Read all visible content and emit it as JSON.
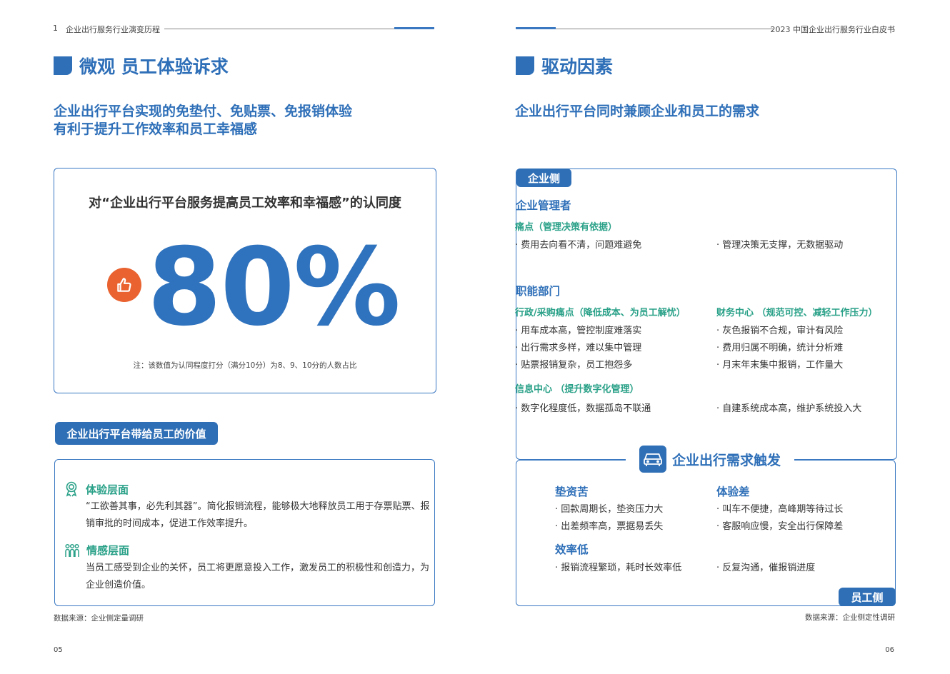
{
  "left_page": {
    "header": {
      "chapter_no": "1",
      "chapter_title": "企业出行服务行业演变历程"
    },
    "section_title": "微观 员工体验诉求",
    "subtitle_lines": [
      "企业出行平台实现的免垫付、免贴票、免报销体验",
      "有利于提升工作效率和员工幸福感"
    ],
    "stat": {
      "question": "对“企业出行平台服务提高员工效率和幸福感”的认同度",
      "value": "80%",
      "note": "注：该数值为认同程度打分（满分10分）为8、9、10分的人数占比"
    },
    "value_pill": "企业出行平台带给员工的价值",
    "levels": [
      {
        "title": "体验层面",
        "icon": "award-icon",
        "body": "“工欲善其事，必先利其器”。简化报销流程，能够极大地释放员工用于存票贴票、报销审批的时间成本，促进工作效率提升。"
      },
      {
        "title": "情感层面",
        "icon": "people-icon",
        "body": "当员工感受到企业的关怀，员工将更愿意投入工作，激发员工的积极性和创造力，为企业创造价值。"
      }
    ],
    "source": "数据来源：企业侧定量调研",
    "page_number": "05"
  },
  "right_page": {
    "header": {
      "title": "2023 中国企业出行服务行业白皮书"
    },
    "section_title": "驱动因素",
    "subtitle": "企业出行平台同时兼顾企业和员工的需求",
    "enterprise_pill": "企业侧",
    "managers": {
      "title": "企业管理者",
      "pain_title": "痛点（管理决策有依据）",
      "left": [
        "· 费用去向看不清，问题难避免"
      ],
      "right": [
        "· 管理决策无支撑，无数据驱动"
      ]
    },
    "departments": {
      "title": "职能部门",
      "admin_pain": "行政/采购痛点（降低成本、为员工解忧）",
      "admin_items": [
        "· 用车成本高，管控制度难落实",
        "· 出行需求多样，难以集中管理",
        "· 贴票报销复杂，员工抱怨多"
      ],
      "finance_pain": "财务中心 （规范可控、减轻工作压力）",
      "finance_items": [
        "· 灰色报销不合规，审计有风险",
        "· 费用归属不明确，统计分析难",
        "· 月末年末集中报销，工作量大"
      ],
      "it_pain": "信息中心 （提升数字化管理）",
      "it_left": "· 数字化程度低，数据孤岛不联通",
      "it_right": "· 自建系统成本高，维护系统投入大"
    },
    "trigger": {
      "title": "企业出行需求触发",
      "icon": "car-icon",
      "advance": {
        "title": "垫资苦",
        "items": [
          "· 回款周期长，垫资压力大",
          "· 出差频率高，票据易丢失"
        ]
      },
      "experience": {
        "title": "体验差",
        "items": [
          "· 叫车不便捷，高峰期等待过长",
          "· 客服响应慢，安全出行保障差"
        ]
      },
      "efficiency": {
        "title": "效率低",
        "left": "· 报销流程繁琐，耗时长效率低",
        "right": "· 反复沟通，催报销进度"
      }
    },
    "employee_pill": "员工侧",
    "source": "数据来源：企业侧定性调研",
    "page_number": "06"
  }
}
